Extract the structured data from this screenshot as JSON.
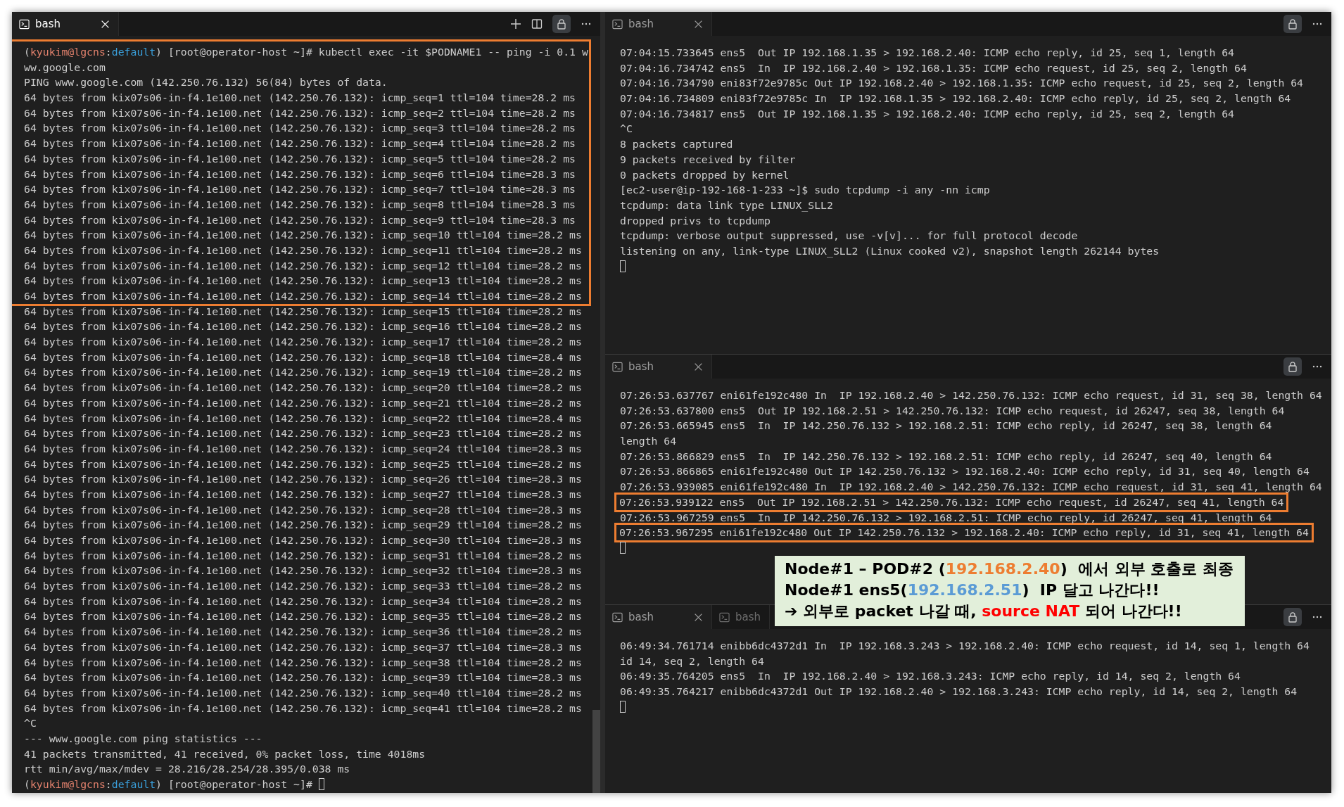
{
  "panes": [
    {
      "focused": true,
      "tabs": [
        {
          "label": "bash",
          "selected": true,
          "closable": true
        }
      ],
      "toolbar": [
        {
          "kind": "plus"
        },
        {
          "kind": "split"
        },
        {
          "kind": "lock"
        },
        {
          "kind": "more"
        }
      ],
      "scrollbar": true,
      "lines": [
        {
          "boxed": true,
          "segments": [
            {
              "kind": "plain",
              "text": "("
            },
            {
              "kind": "user",
              "text": "kyukim@lgcns"
            },
            {
              "kind": "plain",
              "text": ":"
            },
            {
              "kind": "context",
              "text": "default"
            },
            {
              "kind": "plain",
              "text": ") [root@operator-host ~]# kubectl exec -it $PODNAME1 -- ping -i 0.1 w"
            }
          ]
        },
        {
          "boxed": true,
          "text": "ww.google.com"
        },
        {
          "boxed": true,
          "text": "PING www.google.com (142.250.76.132) 56(84) bytes of data."
        },
        {
          "boxed": true,
          "text": "64 bytes from kix07s06-in-f4.1e100.net (142.250.76.132): icmp_seq=1 ttl=104 time=28.2 ms"
        },
        {
          "boxed": true,
          "text": "64 bytes from kix07s06-in-f4.1e100.net (142.250.76.132): icmp_seq=2 ttl=104 time=28.2 ms"
        },
        {
          "boxed": true,
          "text": "64 bytes from kix07s06-in-f4.1e100.net (142.250.76.132): icmp_seq=3 ttl=104 time=28.2 ms"
        },
        {
          "boxed": true,
          "text": "64 bytes from kix07s06-in-f4.1e100.net (142.250.76.132): icmp_seq=4 ttl=104 time=28.2 ms"
        },
        {
          "boxed": true,
          "text": "64 bytes from kix07s06-in-f4.1e100.net (142.250.76.132): icmp_seq=5 ttl=104 time=28.2 ms"
        },
        {
          "boxed": true,
          "text": "64 bytes from kix07s06-in-f4.1e100.net (142.250.76.132): icmp_seq=6 ttl=104 time=28.3 ms"
        },
        {
          "boxed": true,
          "text": "64 bytes from kix07s06-in-f4.1e100.net (142.250.76.132): icmp_seq=7 ttl=104 time=28.3 ms"
        },
        {
          "boxed": true,
          "text": "64 bytes from kix07s06-in-f4.1e100.net (142.250.76.132): icmp_seq=8 ttl=104 time=28.3 ms"
        },
        {
          "boxed": true,
          "text": "64 bytes from kix07s06-in-f4.1e100.net (142.250.76.132): icmp_seq=9 ttl=104 time=28.3 ms"
        },
        {
          "boxed": true,
          "text": "64 bytes from kix07s06-in-f4.1e100.net (142.250.76.132): icmp_seq=10 ttl=104 time=28.2 ms"
        },
        {
          "boxed": true,
          "text": "64 bytes from kix07s06-in-f4.1e100.net (142.250.76.132): icmp_seq=11 ttl=104 time=28.2 ms"
        },
        {
          "boxed": true,
          "text": "64 bytes from kix07s06-in-f4.1e100.net (142.250.76.132): icmp_seq=12 ttl=104 time=28.2 ms"
        },
        {
          "boxed": true,
          "text": "64 bytes from kix07s06-in-f4.1e100.net (142.250.76.132): icmp_seq=13 ttl=104 time=28.2 ms"
        },
        {
          "boxed": true,
          "text": "64 bytes from kix07s06-in-f4.1e100.net (142.250.76.132): icmp_seq=14 ttl=104 time=28.2 ms"
        },
        {
          "boxed": false,
          "text": "64 bytes from kix07s06-in-f4.1e100.net (142.250.76.132): icmp_seq=15 ttl=104 time=28.2 ms"
        },
        {
          "boxed": false,
          "text": "64 bytes from kix07s06-in-f4.1e100.net (142.250.76.132): icmp_seq=16 ttl=104 time=28.2 ms"
        },
        {
          "boxed": false,
          "text": "64 bytes from kix07s06-in-f4.1e100.net (142.250.76.132): icmp_seq=17 ttl=104 time=28.2 ms"
        },
        {
          "boxed": false,
          "text": "64 bytes from kix07s06-in-f4.1e100.net (142.250.76.132): icmp_seq=18 ttl=104 time=28.4 ms"
        },
        {
          "boxed": false,
          "text": "64 bytes from kix07s06-in-f4.1e100.net (142.250.76.132): icmp_seq=19 ttl=104 time=28.2 ms"
        },
        {
          "boxed": false,
          "text": "64 bytes from kix07s06-in-f4.1e100.net (142.250.76.132): icmp_seq=20 ttl=104 time=28.2 ms"
        },
        {
          "boxed": false,
          "text": "64 bytes from kix07s06-in-f4.1e100.net (142.250.76.132): icmp_seq=21 ttl=104 time=28.2 ms"
        },
        {
          "boxed": false,
          "text": "64 bytes from kix07s06-in-f4.1e100.net (142.250.76.132): icmp_seq=22 ttl=104 time=28.4 ms"
        },
        {
          "boxed": false,
          "text": "64 bytes from kix07s06-in-f4.1e100.net (142.250.76.132): icmp_seq=23 ttl=104 time=28.2 ms"
        },
        {
          "boxed": false,
          "text": "64 bytes from kix07s06-in-f4.1e100.net (142.250.76.132): icmp_seq=24 ttl=104 time=28.3 ms"
        },
        {
          "boxed": false,
          "text": "64 bytes from kix07s06-in-f4.1e100.net (142.250.76.132): icmp_seq=25 ttl=104 time=28.2 ms"
        },
        {
          "boxed": false,
          "text": "64 bytes from kix07s06-in-f4.1e100.net (142.250.76.132): icmp_seq=26 ttl=104 time=28.3 ms"
        },
        {
          "boxed": false,
          "text": "64 bytes from kix07s06-in-f4.1e100.net (142.250.76.132): icmp_seq=27 ttl=104 time=28.3 ms"
        },
        {
          "boxed": false,
          "text": "64 bytes from kix07s06-in-f4.1e100.net (142.250.76.132): icmp_seq=28 ttl=104 time=28.3 ms"
        },
        {
          "boxed": false,
          "text": "64 bytes from kix07s06-in-f4.1e100.net (142.250.76.132): icmp_seq=29 ttl=104 time=28.2 ms"
        },
        {
          "boxed": false,
          "text": "64 bytes from kix07s06-in-f4.1e100.net (142.250.76.132): icmp_seq=30 ttl=104 time=28.3 ms"
        },
        {
          "boxed": false,
          "text": "64 bytes from kix07s06-in-f4.1e100.net (142.250.76.132): icmp_seq=31 ttl=104 time=28.2 ms"
        },
        {
          "boxed": false,
          "text": "64 bytes from kix07s06-in-f4.1e100.net (142.250.76.132): icmp_seq=32 ttl=104 time=28.3 ms"
        },
        {
          "boxed": false,
          "text": "64 bytes from kix07s06-in-f4.1e100.net (142.250.76.132): icmp_seq=33 ttl=104 time=28.2 ms"
        },
        {
          "boxed": false,
          "text": "64 bytes from kix07s06-in-f4.1e100.net (142.250.76.132): icmp_seq=34 ttl=104 time=28.2 ms"
        },
        {
          "boxed": false,
          "text": "64 bytes from kix07s06-in-f4.1e100.net (142.250.76.132): icmp_seq=35 ttl=104 time=28.2 ms"
        },
        {
          "boxed": false,
          "text": "64 bytes from kix07s06-in-f4.1e100.net (142.250.76.132): icmp_seq=36 ttl=104 time=28.2 ms"
        },
        {
          "boxed": false,
          "text": "64 bytes from kix07s06-in-f4.1e100.net (142.250.76.132): icmp_seq=37 ttl=104 time=28.3 ms"
        },
        {
          "boxed": false,
          "text": "64 bytes from kix07s06-in-f4.1e100.net (142.250.76.132): icmp_seq=38 ttl=104 time=28.2 ms"
        },
        {
          "boxed": false,
          "text": "64 bytes from kix07s06-in-f4.1e100.net (142.250.76.132): icmp_seq=39 ttl=104 time=28.3 ms"
        },
        {
          "boxed": false,
          "text": "64 bytes from kix07s06-in-f4.1e100.net (142.250.76.132): icmp_seq=40 ttl=104 time=28.2 ms"
        },
        {
          "boxed": false,
          "text": "64 bytes from kix07s06-in-f4.1e100.net (142.250.76.132): icmp_seq=41 ttl=104 time=28.2 ms"
        },
        {
          "boxed": false,
          "text": "^C"
        },
        {
          "boxed": false,
          "text": "--- www.google.com ping statistics ---"
        },
        {
          "boxed": false,
          "text": "41 packets transmitted, 41 received, 0% packet loss, time 4018ms"
        },
        {
          "boxed": false,
          "text": "rtt min/avg/max/mdev = 28.216/28.254/28.395/0.038 ms"
        },
        {
          "boxed": false,
          "segments": [
            {
              "kind": "plain",
              "text": "("
            },
            {
              "kind": "user",
              "text": "kyukim@lgcns"
            },
            {
              "kind": "plain",
              "text": ":"
            },
            {
              "kind": "context",
              "text": "default"
            },
            {
              "kind": "plain",
              "text": ") [root@operator-host ~]# "
            }
          ],
          "cursor": true
        }
      ]
    },
    {
      "focused": false,
      "tabs": [
        {
          "label": "bash",
          "selected": true,
          "closable": true
        }
      ],
      "toolbar": [
        {
          "kind": "lock"
        },
        {
          "kind": "more"
        }
      ],
      "lines": [
        {
          "text": "07:04:15.733645 ens5  Out IP 192.168.1.35 > 192.168.2.40: ICMP echo reply, id 25, seq 1, length 64"
        },
        {
          "text": "07:04:16.734742 ens5  In  IP 192.168.2.40 > 192.168.1.35: ICMP echo request, id 25, seq 2, length 64"
        },
        {
          "text": "07:04:16.734790 eni83f72e9785c Out IP 192.168.2.40 > 192.168.1.35: ICMP echo request, id 25, seq 2, length 64"
        },
        {
          "text": "07:04:16.734809 eni83f72e9785c In  IP 192.168.1.35 > 192.168.2.40: ICMP echo reply, id 25, seq 2, length 64"
        },
        {
          "text": "07:04:16.734817 ens5  Out IP 192.168.1.35 > 192.168.2.40: ICMP echo reply, id 25, seq 2, length 64"
        },
        {
          "text": "^C"
        },
        {
          "text": "8 packets captured"
        },
        {
          "text": "9 packets received by filter"
        },
        {
          "text": "0 packets dropped by kernel"
        },
        {
          "text": "[ec2-user@ip-192-168-1-233 ~]$ sudo tcpdump -i any -nn icmp"
        },
        {
          "text": "tcpdump: data link type LINUX_SLL2"
        },
        {
          "text": "dropped privs to tcpdump"
        },
        {
          "text": "tcpdump: verbose output suppressed, use -v[v]... for full protocol decode"
        },
        {
          "text": "listening on any, link-type LINUX_SLL2 (Linux cooked v2), snapshot length 262144 bytes"
        },
        {
          "cursor": true
        }
      ]
    },
    {
      "focused": false,
      "tabs": [
        {
          "label": "bash",
          "selected": true,
          "closable": true
        }
      ],
      "toolbar": [
        {
          "kind": "lock"
        },
        {
          "kind": "more"
        }
      ],
      "lines": [
        {
          "text": "07:26:53.637767 eni61fe192c480 In  IP 192.168.2.40 > 142.250.76.132: ICMP echo request, id 31, seq 38, length 64",
          "highlighted": false
        },
        {
          "text": "07:26:53.637800 ens5  Out IP 192.168.2.51 > 142.250.76.132: ICMP echo request, id 26247, seq 38, length 64",
          "highlighted": false
        },
        {
          "text": "07:26:53.665945 ens5  In  IP 142.250.76.132 > 192.168.2.51: ICMP echo reply, id 26247, seq 38, length 64",
          "highlighted": false
        },
        {
          "text": "length 64",
          "highlighted": false
        },
        {
          "text": "07:26:53.866829 ens5  In  IP 142.250.76.132 > 192.168.2.51: ICMP echo reply, id 26247, seq 40, length 64",
          "highlighted": false
        },
        {
          "text": "07:26:53.866865 eni61fe192c480 Out IP 142.250.76.132 > 192.168.2.40: ICMP echo reply, id 31, seq 40, length 64",
          "highlighted": false
        },
        {
          "text": "07:26:53.939085 eni61fe192c480 In  IP 192.168.2.40 > 142.250.76.132: ICMP echo request, id 31, seq 41, length 64",
          "highlighted": false
        },
        {
          "text": "07:26:53.939122 ens5  Out IP 192.168.2.51 > 142.250.76.132: ICMP echo request, id 26247, seq 41, length 64",
          "highlighted": true
        },
        {
          "text": "07:26:53.967259 ens5  In  IP 142.250.76.132 > 192.168.2.51: ICMP echo reply, id 26247, seq 41, length 64",
          "highlighted": false
        },
        {
          "text": "07:26:53.967295 eni61fe192c480 Out IP 142.250.76.132 > 192.168.2.40: ICMP echo reply, id 31, seq 41, length 64",
          "highlighted": true
        },
        {
          "cursor": true,
          "highlighted": false
        }
      ]
    },
    {
      "focused": false,
      "tabs": [
        {
          "label": "bash",
          "selected": true,
          "closable": true
        },
        {
          "label": "bash",
          "selected": false,
          "closable": false
        }
      ],
      "toolbar": [
        {
          "kind": "lock"
        },
        {
          "kind": "more"
        }
      ],
      "lines": [
        {
          "text": "06:49:34.761714 enibb6dc4372d1 In  IP 192.168.3.243 > 192.168.2.40: ICMP echo request, id 14, seq 1, length 64"
        },
        {
          "text": "id 14, seq 2, length 64"
        },
        {
          "text": "06:49:35.764205 ens5  In  IP 192.168.2.40 > 192.168.3.243: ICMP echo reply, id 14, seq 2, length 64"
        },
        {
          "text": "06:49:35.764217 enibb6dc4372d1 Out IP 192.168.2.40 > 192.168.3.243: ICMP echo reply, id 14, seq 2, length 64"
        },
        {
          "cursor": true
        }
      ]
    }
  ],
  "callout": {
    "lines": [
      [
        {
          "kind": "plain",
          "text": "Node#1 – POD#2 ("
        },
        {
          "kind": "pod-ip",
          "text": "192.168.2.40"
        },
        {
          "kind": "plain",
          "text": ")  에서 외부 호출로 최종"
        }
      ],
      [
        {
          "kind": "plain",
          "text": "Node#1 ens5("
        },
        {
          "kind": "node-ip",
          "text": "192.168.2.51"
        },
        {
          "kind": "plain",
          "text": ")  IP 달고 나간다!!"
        }
      ],
      [
        {
          "kind": "plain",
          "text": "➔ 외부로 packet 나갈 때, "
        },
        {
          "kind": "alert",
          "text": "source NAT"
        },
        {
          "kind": "plain",
          "text": " 되어 나간다!!"
        }
      ]
    ]
  }
}
